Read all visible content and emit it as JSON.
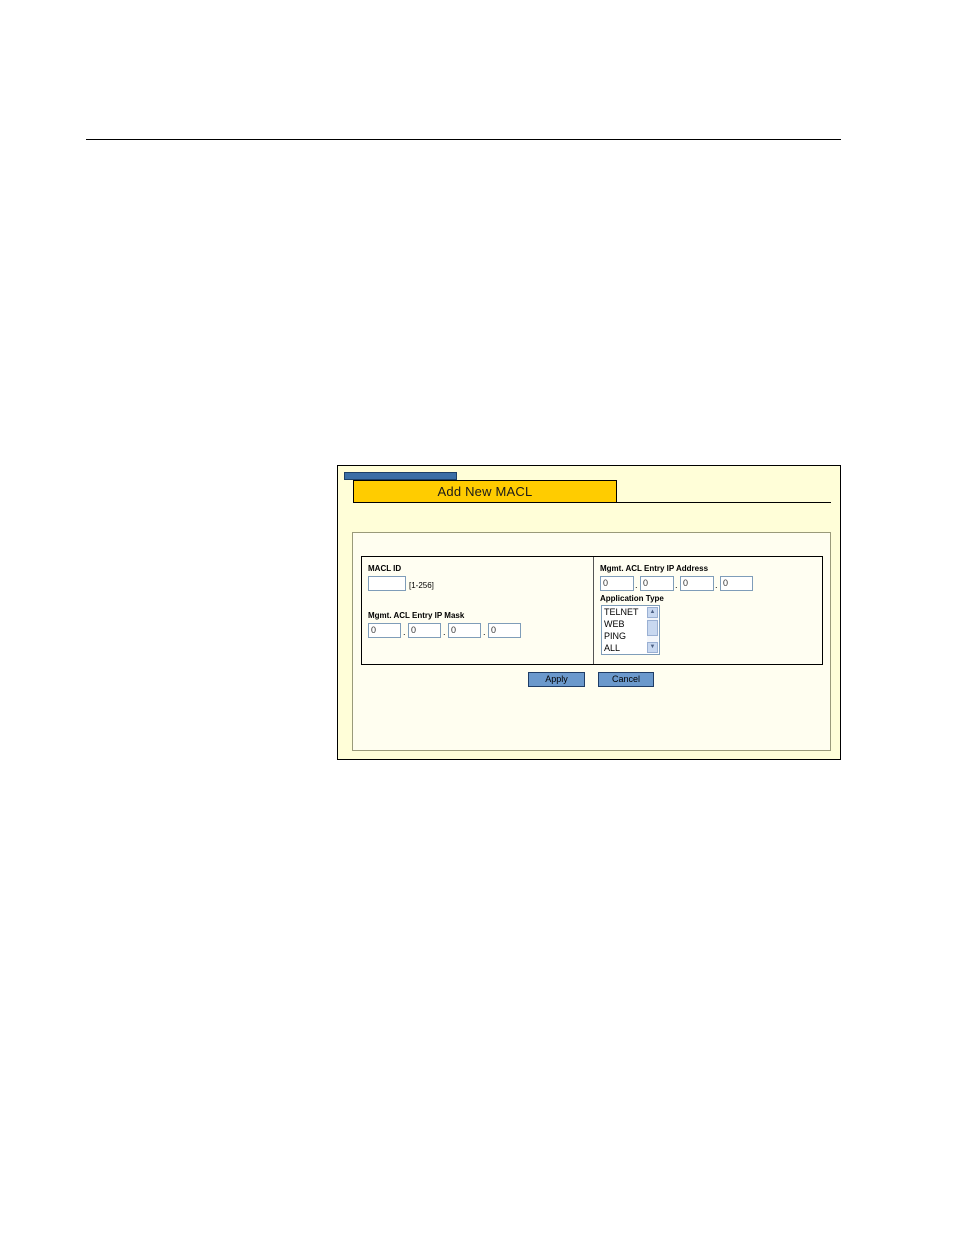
{
  "dialog": {
    "title": "Add New MACL",
    "macl_id": {
      "label": "MACL ID",
      "value": "",
      "range_hint": "[1-256]"
    },
    "ip_mask": {
      "label": "Mgmt. ACL Entry IP Mask",
      "octets": [
        "0",
        "0",
        "0",
        "0"
      ]
    },
    "ip_address": {
      "label": "Mgmt. ACL Entry IP Address",
      "octets": [
        "0",
        "0",
        "0",
        "0"
      ]
    },
    "application_type": {
      "label": "Application Type",
      "options": [
        "TELNET",
        "WEB",
        "PING",
        "ALL"
      ]
    },
    "buttons": {
      "apply": "Apply",
      "cancel": "Cancel"
    },
    "separator": "."
  }
}
